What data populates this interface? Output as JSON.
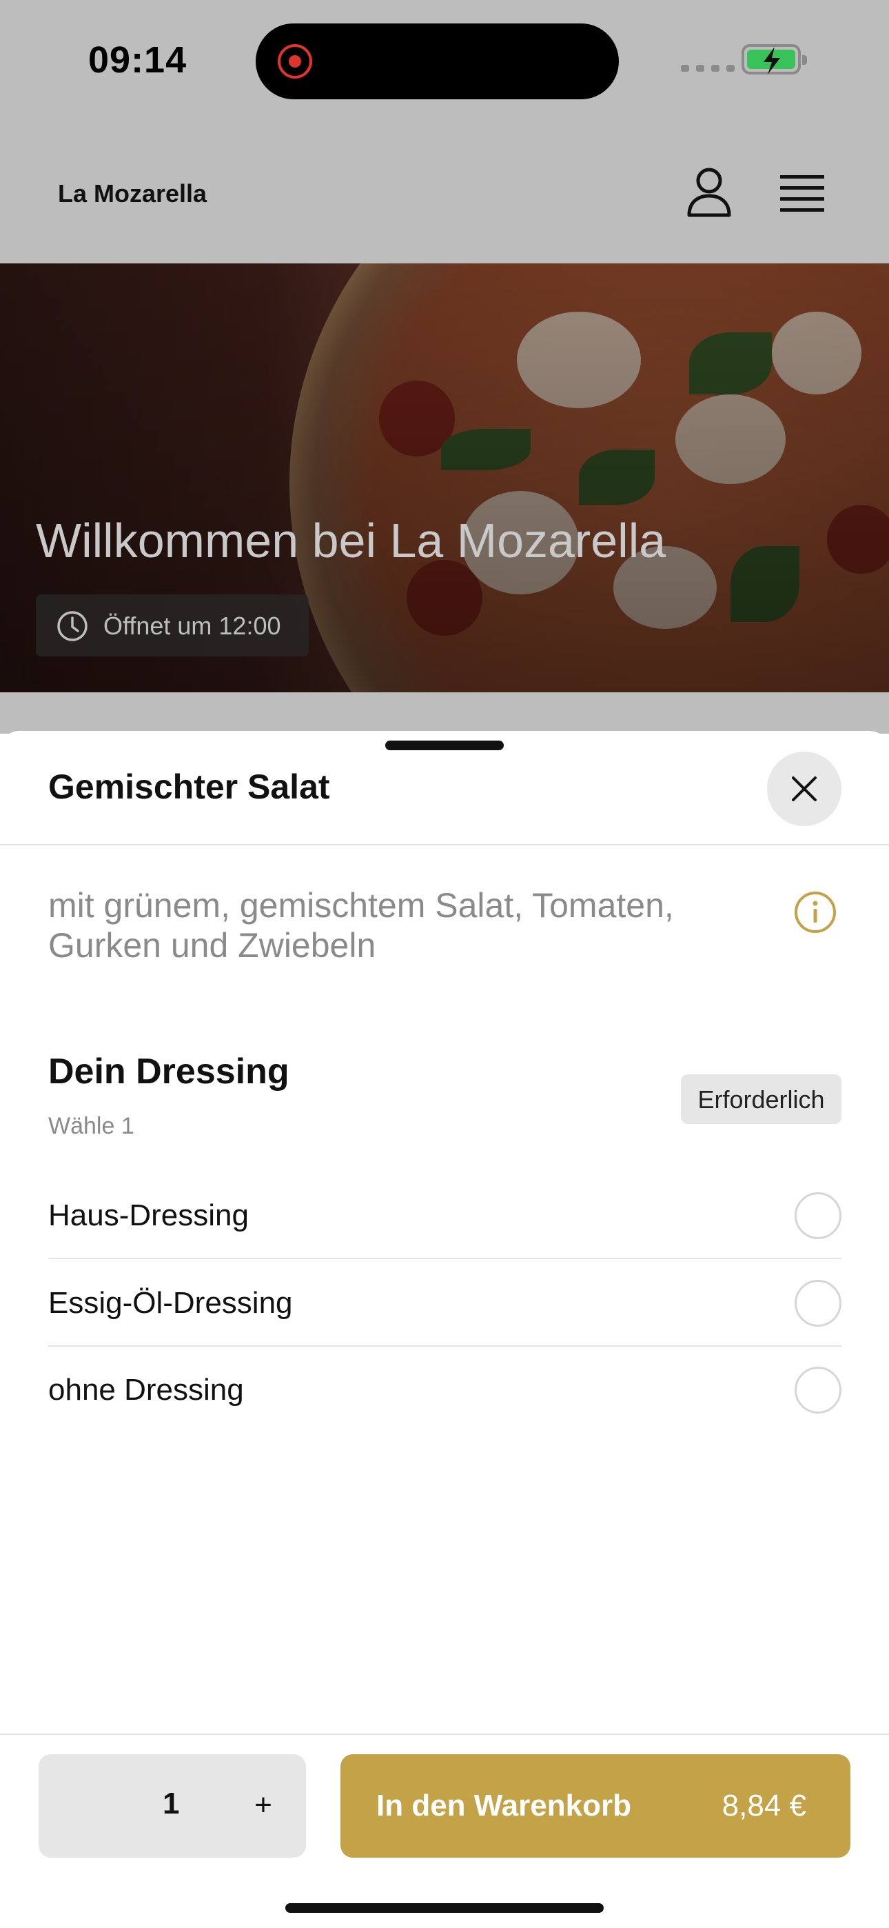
{
  "status_bar": {
    "time": "09:14"
  },
  "header": {
    "brand": "La Mozarella"
  },
  "hero": {
    "title": "Willkommen bei La Mozarella",
    "hours": "Öffnet um 12:00"
  },
  "sheet": {
    "title": "Gemischter Salat",
    "description": "mit grünem, gemischtem Salat, Tomaten, Gurken und Zwiebeln",
    "group": {
      "title": "Dein Dressing",
      "subtitle": "Wähle 1",
      "badge": "Erforderlich",
      "options": [
        {
          "label": "Haus-Dressing",
          "selected": false
        },
        {
          "label": "Essig-Öl-Dressing",
          "selected": false
        },
        {
          "label": "ohne Dressing",
          "selected": false
        }
      ]
    }
  },
  "footer": {
    "quantity": "1",
    "plus": "+",
    "cart_label": "In den Warenkorb",
    "price": "8,84 €"
  },
  "colors": {
    "accent": "#c4a348",
    "overlay": "#bdbdbd"
  },
  "icons": [
    "user-icon",
    "menu-icon",
    "clock-icon",
    "close-icon",
    "info-icon",
    "battery-icon",
    "record-icon"
  ]
}
